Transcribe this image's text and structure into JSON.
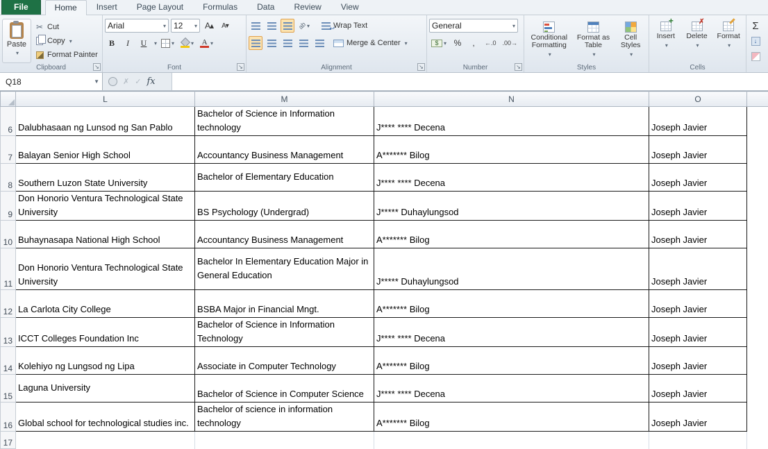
{
  "ribbon": {
    "file_tab": "File",
    "tabs": [
      "Home",
      "Insert",
      "Page Layout",
      "Formulas",
      "Data",
      "Review",
      "View"
    ],
    "active_tab": "Home",
    "clipboard": {
      "label": "Clipboard",
      "paste": "Paste",
      "cut": "Cut",
      "copy": "Copy",
      "format_painter": "Format Painter"
    },
    "font": {
      "label": "Font",
      "family": "Arial",
      "size": "12",
      "bold": "B",
      "italic": "I",
      "underline": "U"
    },
    "alignment": {
      "label": "Alignment",
      "wrap_text": "Wrap Text",
      "merge_center": "Merge & Center"
    },
    "number": {
      "label": "Number",
      "format": "General",
      "currency": "$",
      "percent": "%",
      "comma": ",",
      "inc_decimal": "←.0",
      "dec_decimal": ".00→"
    },
    "styles": {
      "label": "Styles",
      "conditional": "Conditional Formatting",
      "format_table": "Format as Table",
      "cell_styles": "Cell Styles"
    },
    "cells": {
      "label": "Cells",
      "insert": "Insert",
      "delete": "Delete",
      "format": "Format"
    },
    "editing": {
      "autosum": "Σ"
    }
  },
  "formula_bar": {
    "name_box": "Q18",
    "fx": "fx",
    "formula": ""
  },
  "colors": {
    "file_tab_green": "#1e7145",
    "selection_orange": "#fbe3b0",
    "gridline": "#d6dde6",
    "table_border": "#1a1a1a"
  },
  "sheet": {
    "columns": [
      "L",
      "M",
      "N",
      "O"
    ],
    "rows": [
      {
        "num": "6",
        "L": "Dalubhasaan ng Lunsod ng San Pablo",
        "M": "Bachelor of Science in Information technology",
        "N": "J**** **** Decena",
        "O": "Joseph Javier"
      },
      {
        "num": "7",
        "L": "Balayan Senior High School",
        "M": "Accountancy Business Management",
        "N": "A******* Bilog",
        "O": "Joseph Javier"
      },
      {
        "num": "8",
        "L": "Southern Luzon State University",
        "M": "Bachelor of Elementary Education",
        "N": "J**** **** Decena",
        "O": "Joseph Javier"
      },
      {
        "num": "9",
        "L": "Don Honorio Ventura Technological State University",
        "M": "BS Psychology (Undergrad)",
        "N": "J***** Duhaylungsod",
        "O": "Joseph Javier"
      },
      {
        "num": "10",
        "L": "Buhaynasapa National High School",
        "M": "Accountancy Business Management",
        "N": "A******* Bilog",
        "O": "Joseph Javier"
      },
      {
        "num": "11",
        "L": "Don Honorio Ventura Technological State University",
        "M": "Bachelor In Elementary Education Major in General Education",
        "N": "J***** Duhaylungsod",
        "O": "Joseph Javier"
      },
      {
        "num": "12",
        "L": "La Carlota City College",
        "M": "BSBA Major in Financial Mngt.",
        "N": "A******* Bilog",
        "O": "Joseph Javier"
      },
      {
        "num": "13",
        "L": "ICCT Colleges Foundation Inc",
        "M": "Bachelor of Science in Information Technology",
        "N": "J**** **** Decena",
        "O": "Joseph Javier"
      },
      {
        "num": "14",
        "L": "Kolehiyo ng Lungsod ng Lipa",
        "M": "Associate in Computer Technology",
        "N": "A******* Bilog",
        "O": "Joseph Javier"
      },
      {
        "num": "15",
        "L": "Laguna University",
        "M": "Bachelor of Science in Computer Science",
        "N": "J**** **** Decena",
        "O": "Joseph Javier"
      },
      {
        "num": "16",
        "L": "Global school for technological studies inc.",
        "M": "Bachelor of science in information technology",
        "N": "A******* Bilog",
        "O": "Joseph Javier"
      },
      {
        "num": "17",
        "L": "",
        "M": "",
        "N": "",
        "O": ""
      }
    ]
  }
}
